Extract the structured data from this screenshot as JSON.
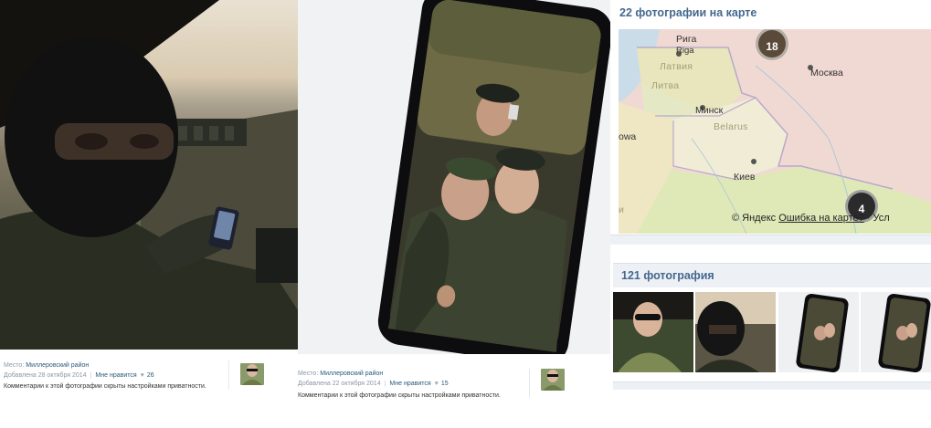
{
  "left_post": {
    "place_label": "Место:",
    "place_value": "Миллеровский район",
    "added_text": "Добавлена 28 октября 2014",
    "like_label": "Мне нравится",
    "like_count": "26",
    "comment_note": "Комментарии к этой фотографии скрыты настройками приватности."
  },
  "middle_post": {
    "place_label": "Место:",
    "place_value": "Миллеровский район",
    "added_text": "Добавлена 22 октября 2014",
    "like_label": "Мне нравится",
    "like_count": "15",
    "comment_note": "Комментарии к этой фотографии скрыты настройками приватности."
  },
  "map_section": {
    "title": "22 фотографии на карте",
    "labels": {
      "riga": "Рига",
      "riga_latin": "Riga",
      "latvia": "Латвия",
      "lithuania": "Литва",
      "minsk": "Минск",
      "belarus": "Belarus",
      "moscow": "Москва",
      "kyiv": "Киев",
      "belarus_partial": "оwa",
      "ukraine_partial": "и"
    },
    "pins": [
      "18",
      "4"
    ],
    "attribution": "© Яндекс",
    "error_link": "Ошибка на карте?",
    "terms_partial": "· Усл"
  },
  "photos_section": {
    "title": "121 фотография",
    "thumbnails": [
      "photo-thumb-1",
      "photo-thumb-2",
      "photo-thumb-3",
      "photo-thumb-4"
    ]
  },
  "colors": {
    "link_blue": "#2b587a",
    "header_blue": "#45688e",
    "map_red": "#f0d7d3",
    "map_green": "#dfe9b8"
  }
}
